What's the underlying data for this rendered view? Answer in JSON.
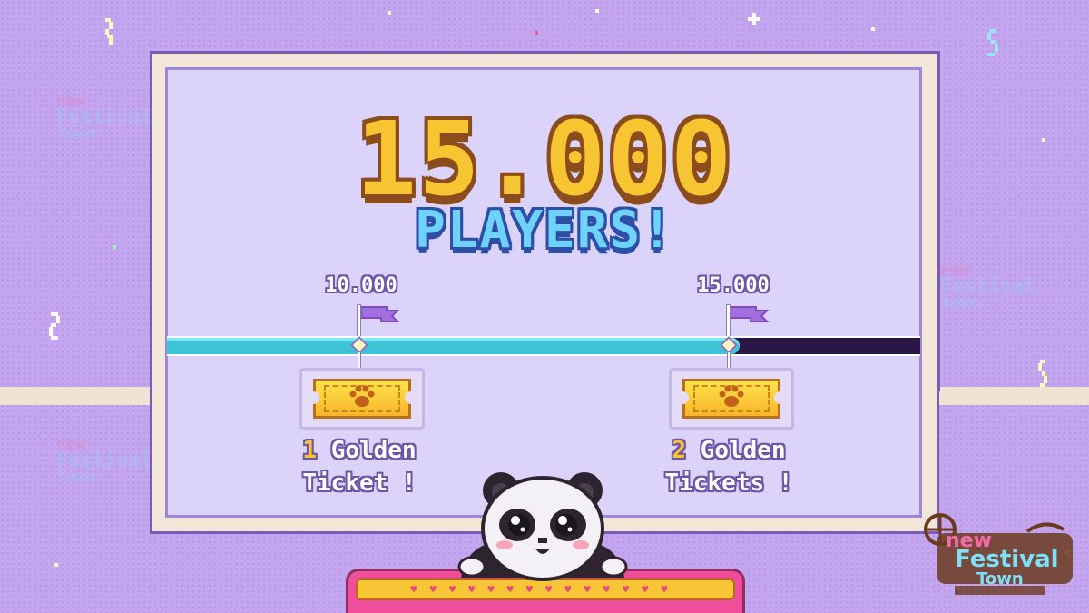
{
  "headline": {
    "number": "15.000",
    "subtitle": "PLAYERS!"
  },
  "progress": {
    "fill_fraction": 0.76,
    "milestones": [
      {
        "label": "10.000",
        "reward_count": "1",
        "reward_text_1": "Golden",
        "reward_text_2": "Ticket !"
      },
      {
        "label": "15.000",
        "reward_count": "2",
        "reward_text_1": "Golden",
        "reward_text_2": "Tickets !"
      }
    ]
  },
  "brand": {
    "logo_line1": "new",
    "logo_line2": "Festival",
    "logo_line3": "Town"
  },
  "colors": {
    "background": "#c4a6ef",
    "panel_inner": "#dcd3fb",
    "gold": "#f7c531",
    "cyan": "#6fd2fb",
    "progress_fill": "#3ec4d6",
    "progress_track": "#2b1744"
  },
  "icons": [
    "flag-icon",
    "paw-icon",
    "sparkle-icon",
    "heart-icon",
    "panda-mascot"
  ]
}
